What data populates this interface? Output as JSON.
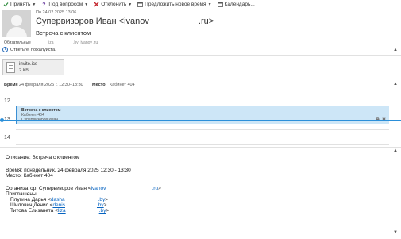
{
  "toolbar": {
    "accept": "Принять",
    "tentative": "Под вопросом",
    "decline": "Отклонить",
    "propose": "Предложить новое время",
    "calendar": "Календарь..."
  },
  "header": {
    "date": "Пн 24.02.2025 13:06",
    "sender": "Супервизоров Иван <ivanov",
    "sender_domain": ".ru>",
    "subject": "Встреча с клиентом"
  },
  "required": {
    "label": "Обязательные",
    "v1": "liza",
    "v2": ".by; ivanov                 .ru"
  },
  "info": {
    "text": "Ответьте, пожалуйста."
  },
  "attachment": {
    "name": "invite.ics",
    "size": "2 KB"
  },
  "meeting": {
    "time_label": "Время",
    "time_value": "24 февраля 2025 г. 12:30–13:30",
    "place_label": "Место",
    "place_value": "Кабинет 404"
  },
  "calendar": {
    "hours": [
      "12",
      "13",
      "14"
    ],
    "event_title": "Встреча с клиентом",
    "event_place": "Кабинет 404",
    "event_organizer": "Супервизоров Иван",
    "accent": "#3b8fd3"
  },
  "body": {
    "description": "Описание: Встреча с клиентом",
    "time": "Время: понедельник, 24 февраля 2025 12:30 - 13:30",
    "place": "Место: Кабинет 404",
    "organizer_prefix": "Организатор: Супервизоров Иван <",
    "organizer_link": "ivanov",
    "organizer_domain": ".ru",
    "organizer_suffix": ">",
    "invited": "Приглашены:",
    "invitees": [
      {
        "name": "Плугина Дарья <",
        "link": "dasha",
        "domain": ".by",
        "suffix": ">"
      },
      {
        "name": "Шилович Денис <",
        "link": "denis",
        "domain": ".by",
        "suffix": ">"
      },
      {
        "name": "Титова Елизавета <",
        "link": "liza",
        "domain": ".by",
        "suffix": ">"
      }
    ]
  }
}
